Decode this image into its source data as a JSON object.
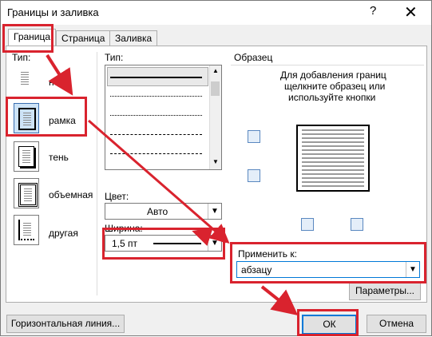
{
  "window": {
    "title": "Границы и заливка",
    "help": "?",
    "close": "✕"
  },
  "tabs": [
    "Граница",
    "Страница",
    "Заливка"
  ],
  "type_section": {
    "label": "Тип:",
    "items": [
      "нет",
      "рамка",
      "тень",
      "объемная",
      "другая"
    ]
  },
  "style_section": {
    "label": "Тип:"
  },
  "color": {
    "label": "Цвет:",
    "value": "Авто"
  },
  "width": {
    "label": "Ширина:",
    "value": "1,5 пт"
  },
  "preview": {
    "label": "Образец",
    "hint_line1": "Для добавления границ",
    "hint_line2": "щелкните образец или",
    "hint_line3": "используйте кнопки"
  },
  "apply_to": {
    "label": "Применить к:",
    "value": "абзацу"
  },
  "buttons": {
    "params": "Параметры...",
    "horizontal_line": "Горизонтальная линия...",
    "ok": "ОК",
    "cancel": "Отмена"
  },
  "colors": {
    "annotation_red": "#d9232e",
    "accent_blue": "#0078d7"
  }
}
